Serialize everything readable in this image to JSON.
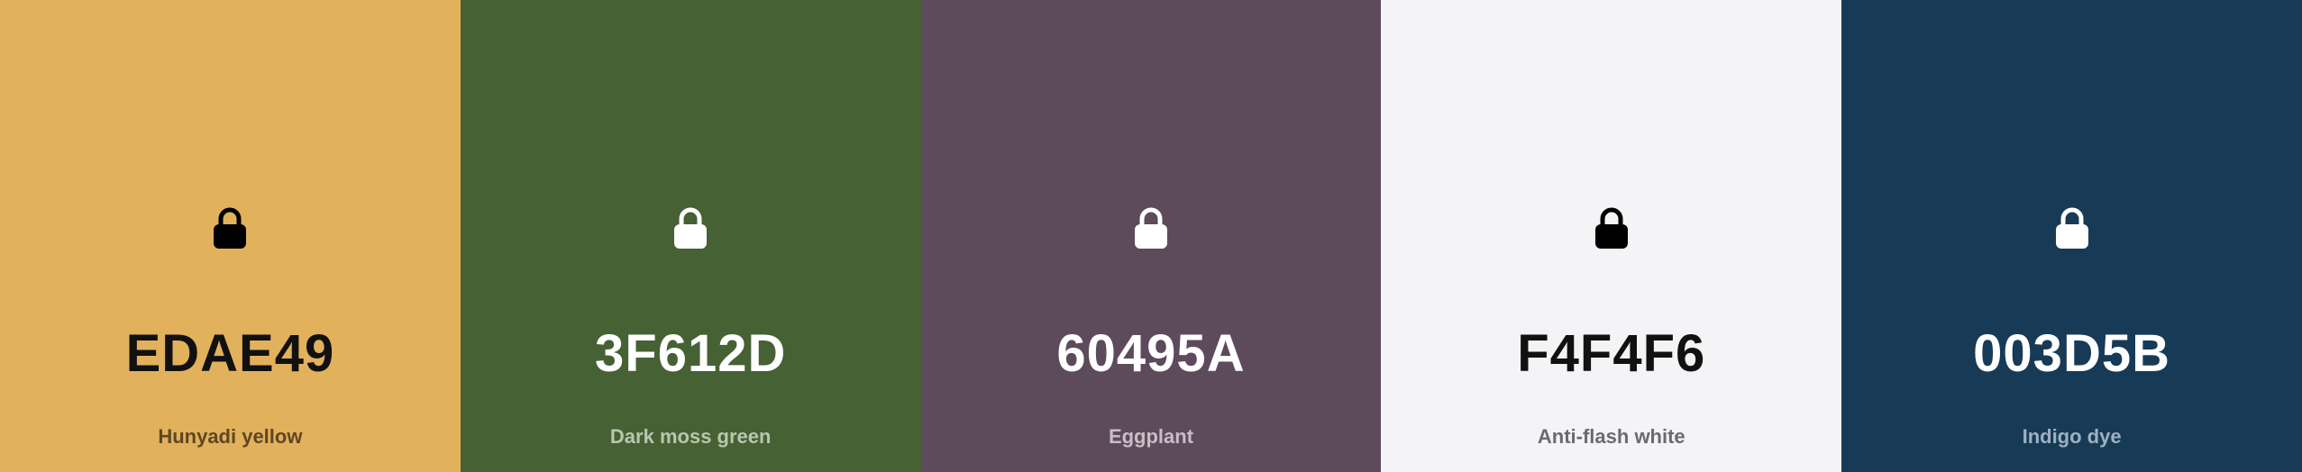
{
  "swatches": [
    {
      "hex": "EDAE49",
      "name": "Hunyadi yellow",
      "background": "#E2B15C",
      "text_color": "#111111",
      "name_color": "#5E4722",
      "icon_color": "#000000",
      "icon": "lock-icon"
    },
    {
      "hex": "3F612D",
      "name": "Dark moss green",
      "background": "#466134",
      "text_color": "#FFFFFF",
      "name_color": "#B8C6AE",
      "icon_color": "#FFFFFF",
      "icon": "lock-icon"
    },
    {
      "hex": "60495A",
      "name": "Eggplant",
      "background": "#5D4A5B",
      "text_color": "#FFFFFF",
      "name_color": "#C8BDC6",
      "icon_color": "#FFFFFF",
      "icon": "lock-icon"
    },
    {
      "hex": "F4F4F6",
      "name": "Anti-flash white",
      "background": "#F4F4F6",
      "text_color": "#111111",
      "name_color": "#6B6B6E",
      "icon_color": "#000000",
      "icon": "lock-icon"
    },
    {
      "hex": "003D5B",
      "name": "Indigo dye",
      "background": "#173A57",
      "text_color": "#FFFFFF",
      "name_color": "#9FB0C1",
      "icon_color": "#FFFFFF",
      "icon": "lock-icon"
    }
  ]
}
